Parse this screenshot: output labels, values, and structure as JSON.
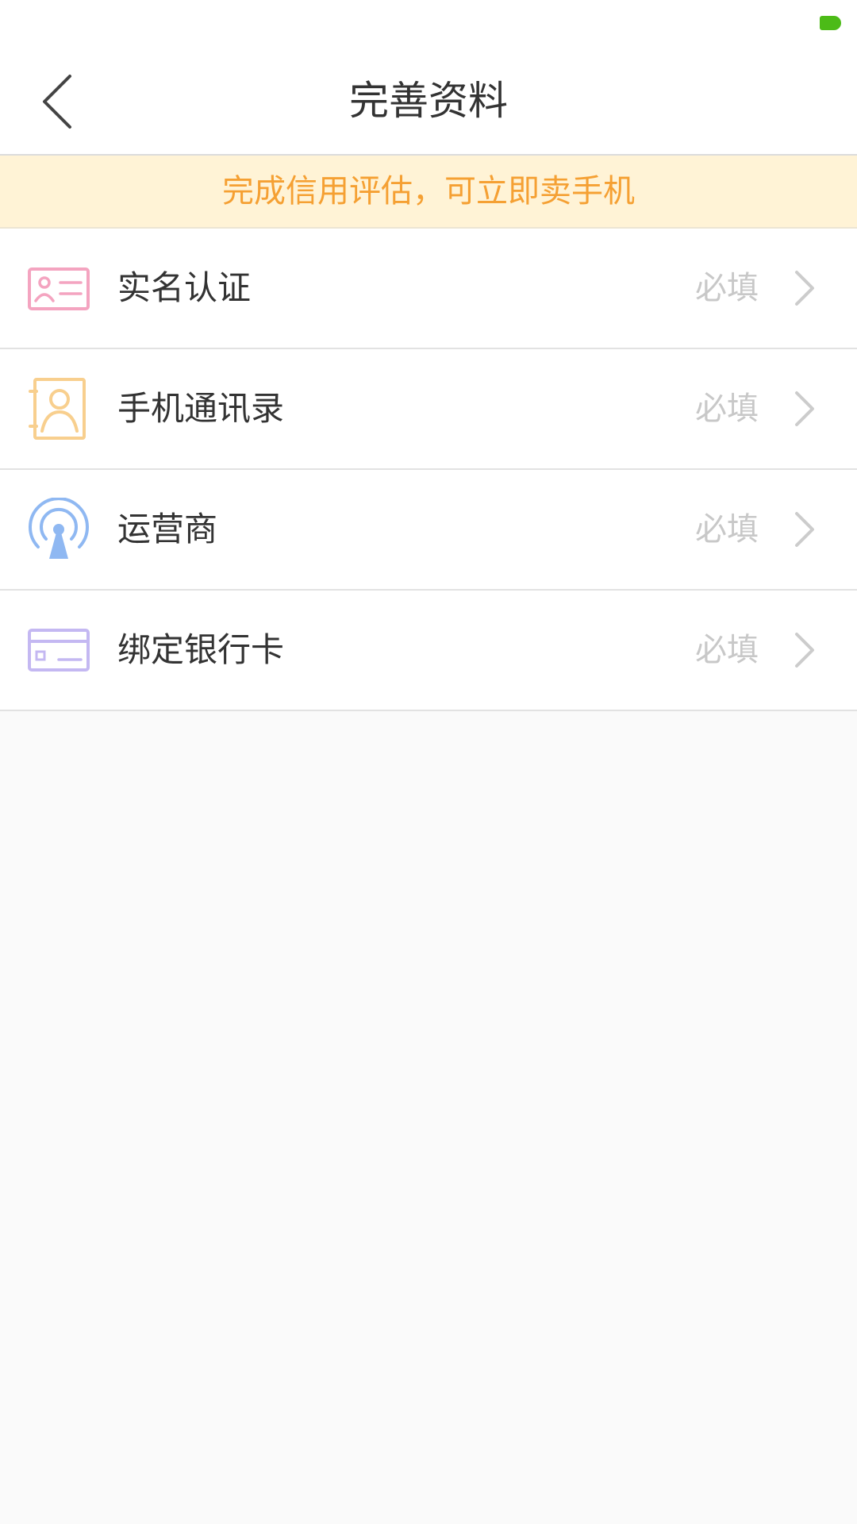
{
  "header": {
    "title": "完善资料"
  },
  "banner": {
    "text": "完成信用评估，可立即卖手机",
    "color": "#f5a033",
    "background": "#fff3d6"
  },
  "items": [
    {
      "label": "实名认证",
      "status": "必填",
      "icon": "id-card-icon",
      "color": "#f4a4c0"
    },
    {
      "label": "手机通讯录",
      "status": "必填",
      "icon": "contacts-book-icon",
      "color": "#f8cf8e"
    },
    {
      "label": "运营商",
      "status": "必填",
      "icon": "signal-tower-icon",
      "color": "#8fb8f2"
    },
    {
      "label": "绑定银行卡",
      "status": "必填",
      "icon": "bank-card-icon",
      "color": "#c4b8f2"
    }
  ]
}
